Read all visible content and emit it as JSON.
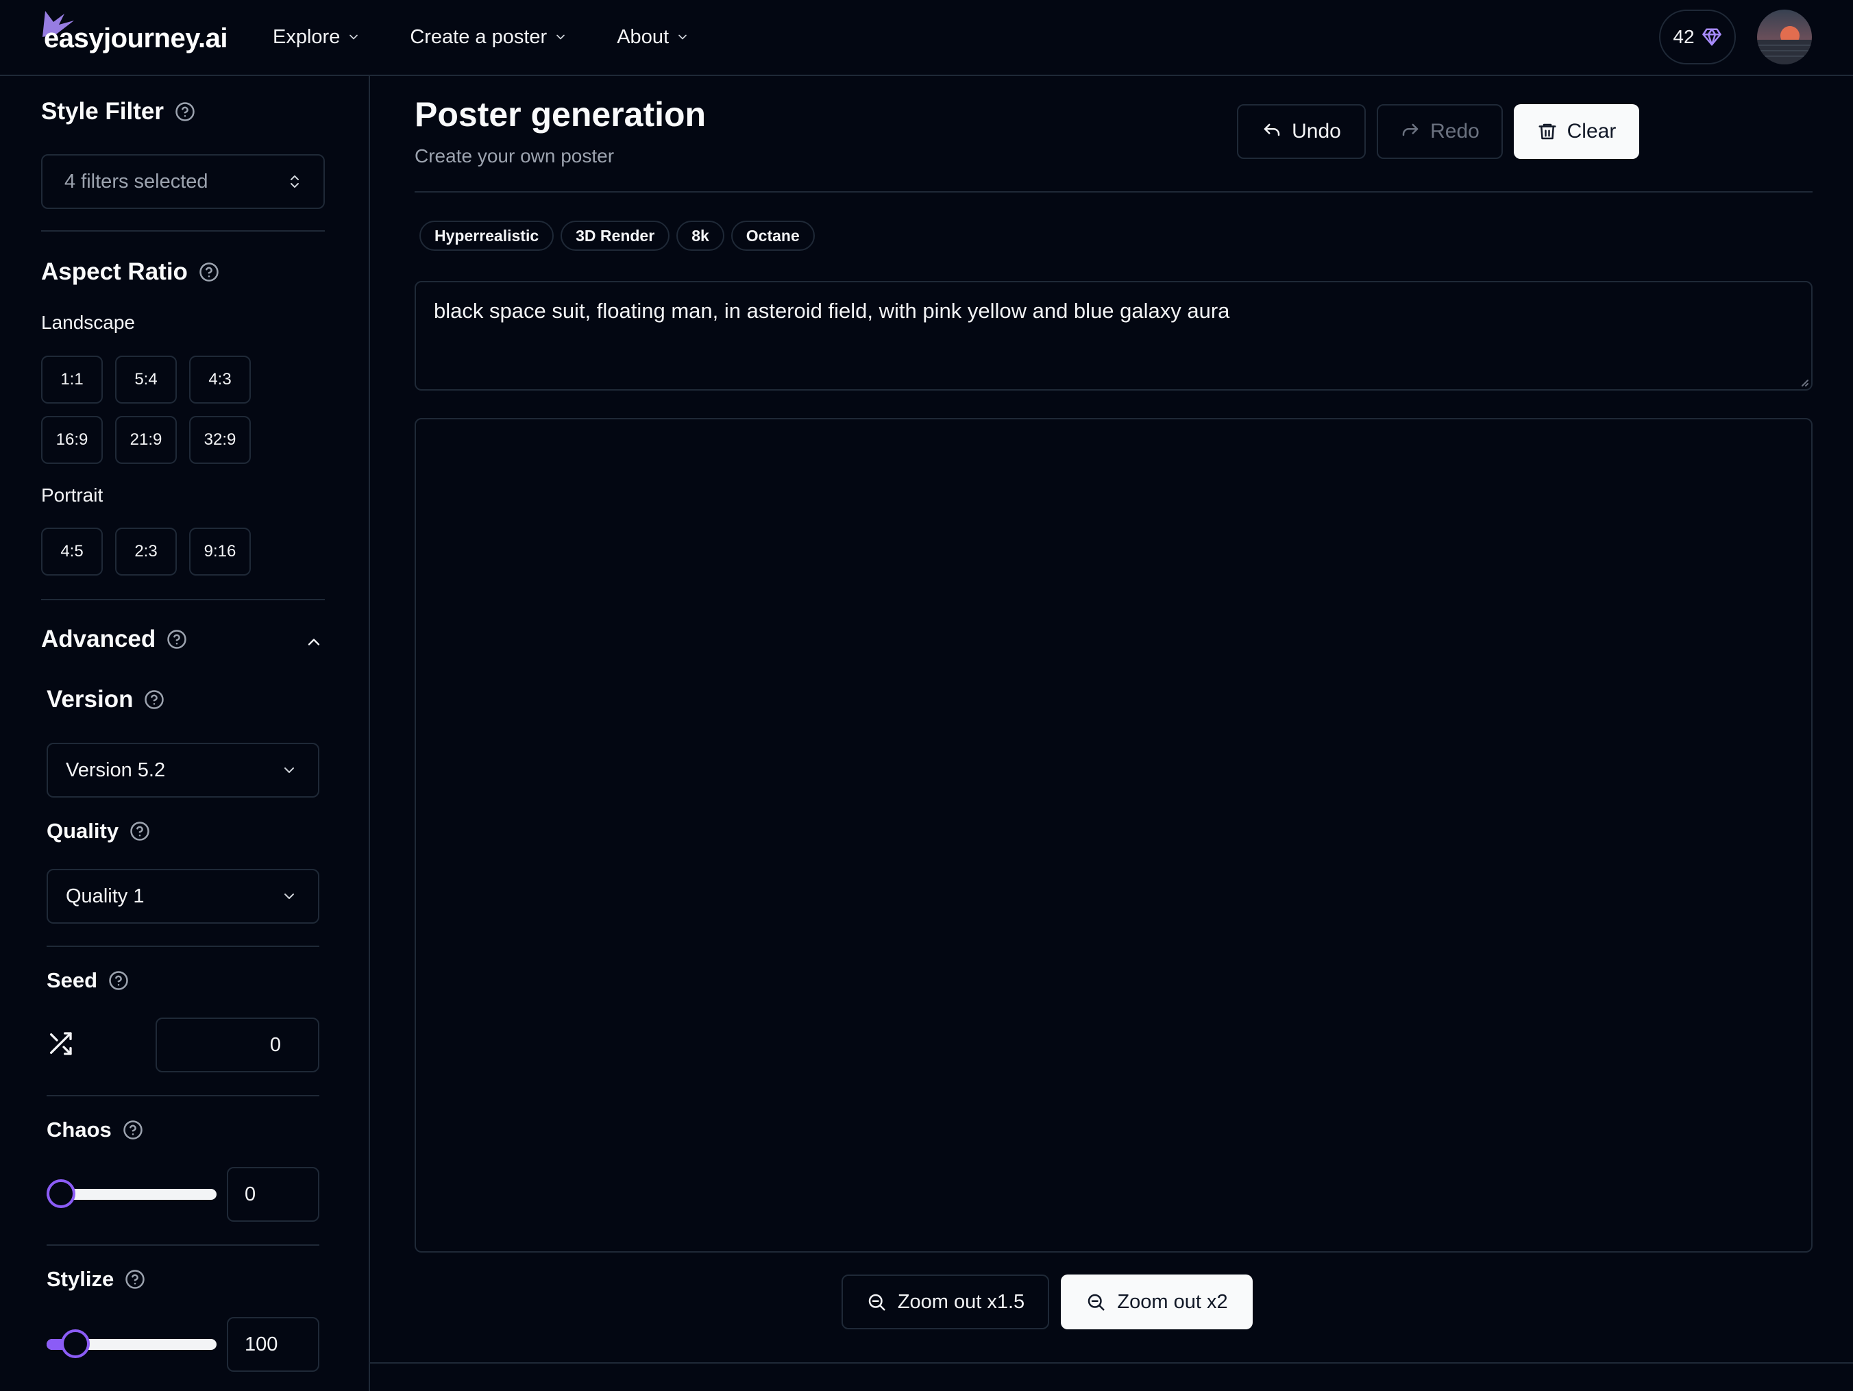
{
  "header": {
    "logo_text": "easyjourney.ai",
    "nav": [
      {
        "label": "Explore",
        "icon": "chevron-down-icon"
      },
      {
        "label": "Create a poster",
        "icon": "chevron-down-icon"
      },
      {
        "label": "About",
        "icon": "chevron-down-icon"
      }
    ],
    "credits": "42",
    "credits_icon": "gem-icon"
  },
  "sidebar": {
    "style_filter": {
      "title": "Style Filter",
      "value": "4 filters selected"
    },
    "aspect_ratio": {
      "title": "Aspect Ratio",
      "landscape_label": "Landscape",
      "landscape_row1": [
        "1:1",
        "5:4",
        "4:3"
      ],
      "landscape_row2": [
        "16:9",
        "21:9",
        "32:9"
      ],
      "portrait_label": "Portrait",
      "portrait": [
        "4:5",
        "2:3",
        "9:16"
      ]
    },
    "advanced": {
      "title": "Advanced",
      "version": {
        "title": "Version",
        "value": "Version 5.2"
      },
      "quality": {
        "title": "Quality",
        "value": "Quality 1"
      },
      "seed": {
        "title": "Seed",
        "value": "0"
      },
      "chaos": {
        "title": "Chaos",
        "value": "0",
        "fraction": 0.0
      },
      "stylize": {
        "title": "Stylize",
        "value": "100",
        "fraction": 0.1
      }
    }
  },
  "main": {
    "title": "Poster generation",
    "subtitle": "Create your own poster",
    "toolbar": {
      "undo": "Undo",
      "redo": "Redo",
      "clear": "Clear"
    },
    "tags": [
      "Hyperrealistic",
      "3D Render",
      "8k",
      "Octane"
    ],
    "prompt": "black space suit, floating man, in asteroid field, with pink yellow and blue galaxy aura",
    "zoom": {
      "zoom_15": "Zoom out x1.5",
      "zoom_2": "Zoom out x2"
    }
  },
  "colors": {
    "background": "#030712",
    "border": "#1f2937",
    "accent": "#8b5cf6"
  }
}
